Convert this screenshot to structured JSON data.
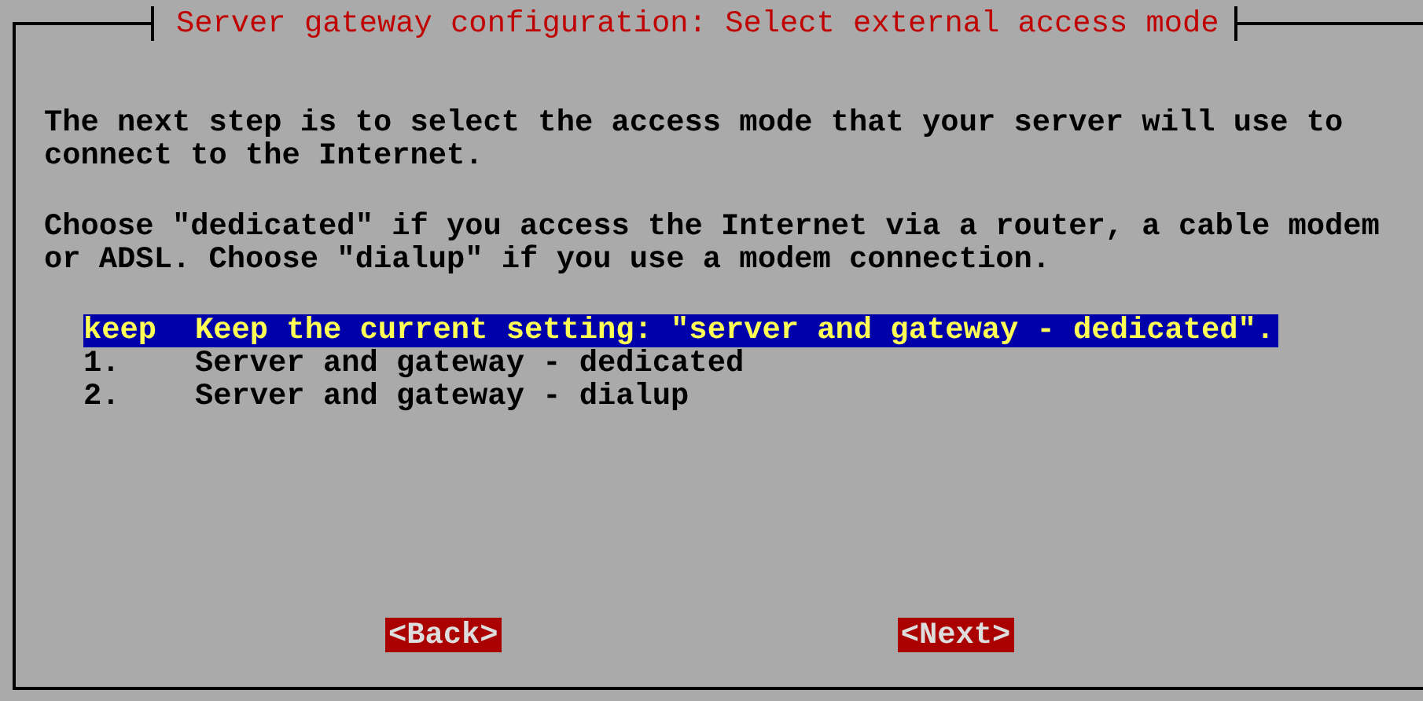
{
  "dialog": {
    "title": "Server gateway configuration: Select external access mode",
    "paragraphs": [
      "The next step is to select the access mode that your server will use to connect to the Internet.",
      "Choose \"dedicated\" if you access the Internet via a router, a cable modem or ADSL. Choose \"dialup\" if you use a modem connection."
    ],
    "options": [
      {
        "tag": "keep",
        "label": "Keep the current setting: \"server and gateway - dedicated\".",
        "selected": true
      },
      {
        "tag": "1.",
        "label": "Server and gateway - dedicated",
        "selected": false
      },
      {
        "tag": "2.",
        "label": "Server and gateway - dialup",
        "selected": false
      }
    ],
    "buttons": [
      "<Back>",
      "<Next>"
    ]
  }
}
